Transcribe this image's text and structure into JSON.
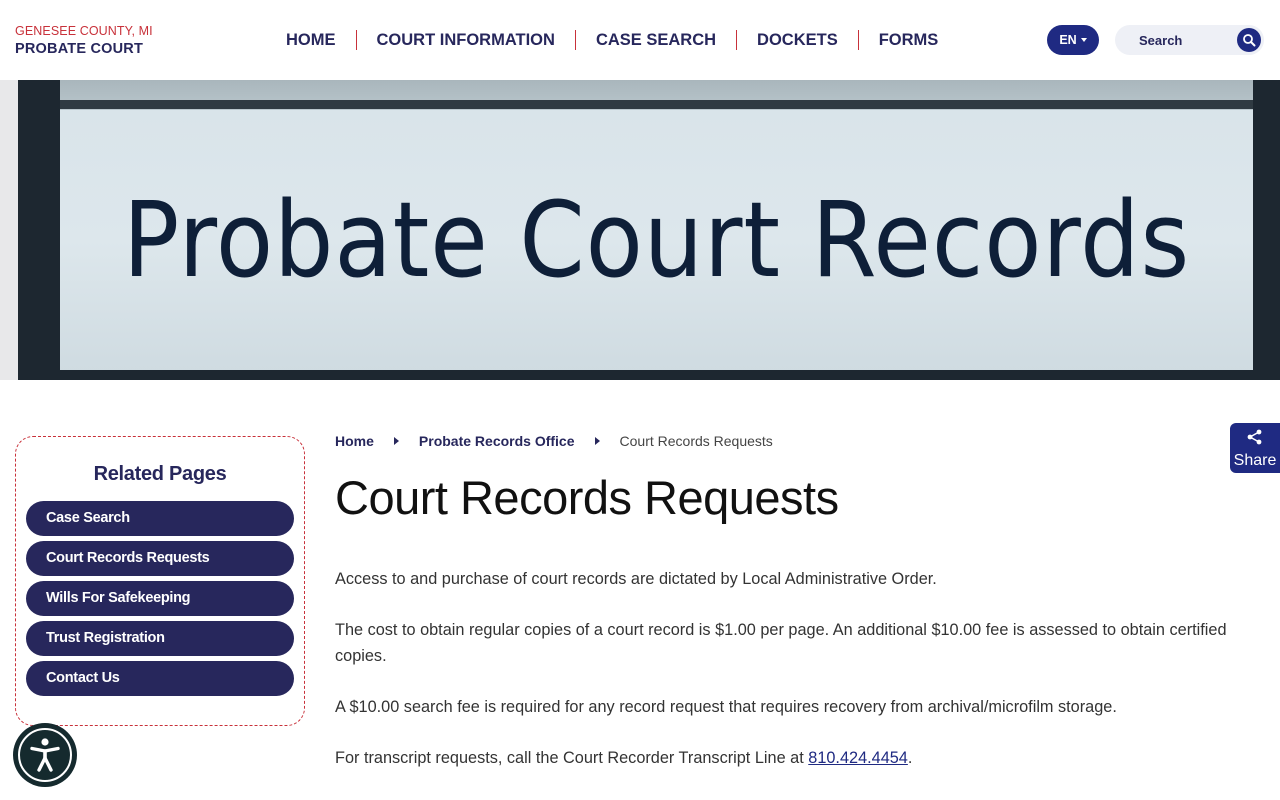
{
  "header": {
    "county": "GENESEE COUNTY, MI",
    "court": "PROBATE COURT",
    "nav": [
      "HOME",
      "COURT INFORMATION",
      "CASE SEARCH",
      "DOCKETS",
      "FORMS"
    ],
    "language": "EN",
    "search_placeholder": "Search"
  },
  "hero": {
    "sign_text": "Probate Court Records"
  },
  "sidebar": {
    "title": "Related Pages",
    "items": [
      "Case Search",
      "Court Records Requests",
      "Wills For Safekeeping",
      "Trust Registration",
      "Contact Us"
    ]
  },
  "breadcrumb": {
    "items": [
      "Home",
      "Probate Records Office"
    ],
    "current": "Court Records Requests"
  },
  "main": {
    "title": "Court Records Requests",
    "paragraphs": [
      "Access to and purchase of court records are dictated by Local Administrative Order.",
      "The cost to obtain regular copies of a court record is $1.00 per page.  An additional $10.00 fee is assessed to obtain certified copies.",
      "A $10.00 search fee is required for any record request that requires recovery from archival/microfilm storage."
    ],
    "transcript_prefix": "For transcript requests, call the Court Recorder Transcript Line at ",
    "transcript_phone": "810.424.4454",
    "transcript_suffix": "."
  },
  "share": {
    "label": "Share"
  },
  "colors": {
    "navy": "#27275c",
    "accent_red": "#c8313a",
    "button_blue": "#1f2a82"
  },
  "icons": [
    "search-icon",
    "chevron-down-icon",
    "share-icon",
    "accessibility-icon",
    "breadcrumb-arrow-icon"
  ]
}
